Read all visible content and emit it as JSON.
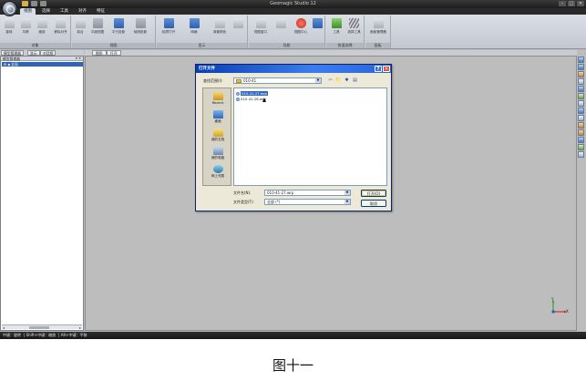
{
  "app": {
    "title": "Geomagic Studio 12"
  },
  "ribbon": {
    "tabs": [
      "视图",
      "选择",
      "工具",
      "对齐",
      "特征"
    ],
    "groups": [
      {
        "label": "对象",
        "buttons": [
          "旋转",
          "平移",
          "缩放",
          "移除对齐"
        ]
      },
      {
        "label": "视图",
        "buttons": [
          "拟合",
          "平面视图",
          "平行投影",
          "轴测投影"
        ]
      },
      {
        "label": "显示",
        "buttons": [
          "轮廓打开",
          "网格",
          "背景颜色"
        ]
      },
      {
        "label": "导航",
        "buttons": [
          "视图窗口",
          "视图中心"
        ]
      },
      {
        "label": "快速选择",
        "buttons": [
          "工具",
          "选择工具"
        ]
      },
      {
        "label": "面板",
        "buttons": [
          "面板管理器"
        ]
      }
    ]
  },
  "left_panel": {
    "tabs": [
      "模型管理器",
      "显示",
      "对话框"
    ],
    "header": "模型管理器",
    "pins": "▾ ✕",
    "tree": [
      "全局"
    ]
  },
  "doc_tabs": [
    "图形",
    "打开"
  ],
  "axis": {
    "y": "Y",
    "x": "X"
  },
  "status_bar": [
    "中键：旋转",
    "Shift+中键：缩放",
    "Alt+中键：平移"
  ],
  "dialog": {
    "title": "打开文件",
    "help_glyph": "?",
    "close_glyph": "✕",
    "lookin_label": "查找范围(I):",
    "lookin_value": "010-41",
    "lookin_tools": [
      "⇦",
      "📁",
      "✱",
      "▤"
    ],
    "places": [
      "Recent",
      "桌面",
      "我的文档",
      "我的电脑",
      "网上邻居"
    ],
    "files": [
      "010-41-27.wrp",
      "010-41-28.wrp"
    ],
    "filename_label": "文件名(N):",
    "filename_value": "010-41-27.wrp",
    "filetype_label": "文件类型(T):",
    "filetype_value": "全部 (*)",
    "open_label": "打开(O)",
    "cancel_label": "取消"
  },
  "caption": "图十一"
}
